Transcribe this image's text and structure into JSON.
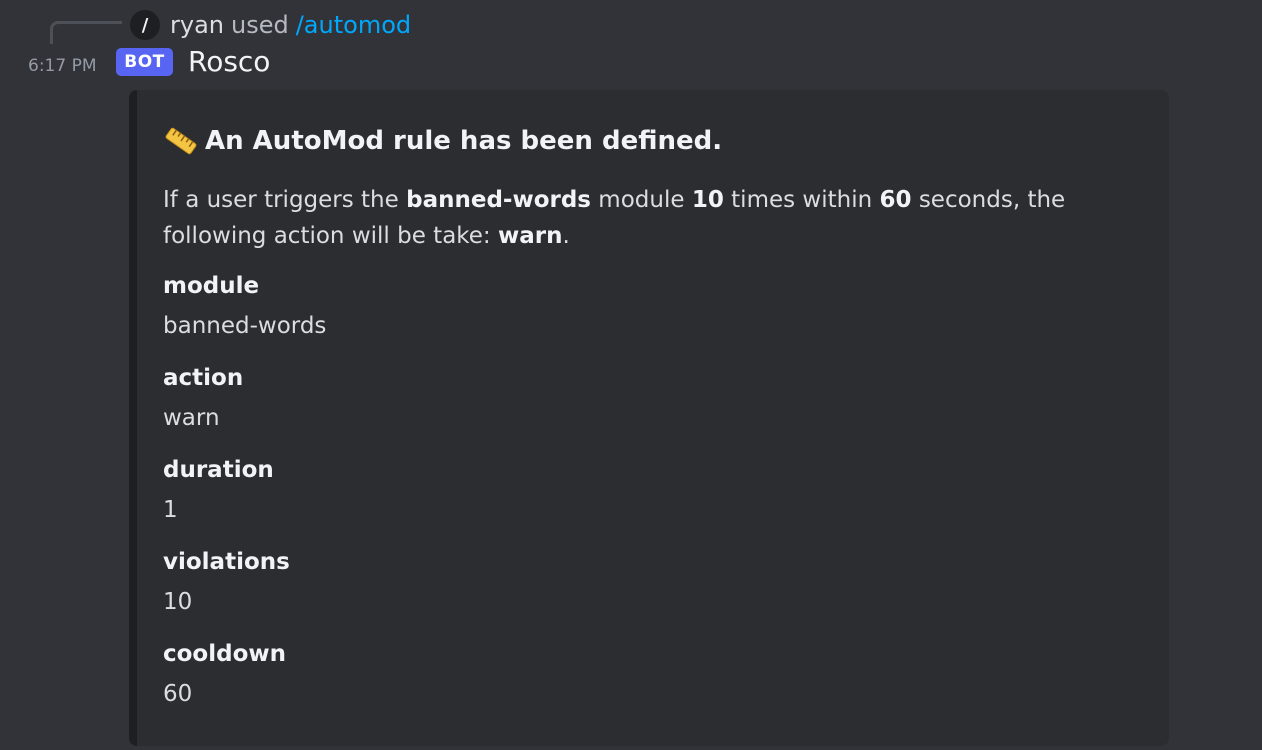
{
  "reply": {
    "icon": "slash-command-icon",
    "user": "ryan",
    "used_text": "used",
    "command": "/automod"
  },
  "message": {
    "timestamp": "6:17 PM",
    "bot_tag": "BOT",
    "author": "Rosco"
  },
  "embed": {
    "title_icon": "ruler-icon",
    "title": "An AutoMod rule has been defined.",
    "description": {
      "part1": "If a user triggers the ",
      "module": "banned-words",
      "part2": " module ",
      "violations": "10",
      "part3": " times within ",
      "seconds": "60",
      "part4": " seconds, the following action will be take: ",
      "action": "warn",
      "part5": "."
    },
    "fields": [
      {
        "name": "module",
        "value": "banned-words"
      },
      {
        "name": "action",
        "value": "warn"
      },
      {
        "name": "duration",
        "value": "1"
      },
      {
        "name": "violations",
        "value": "10"
      },
      {
        "name": "cooldown",
        "value": "60"
      }
    ]
  },
  "colors": {
    "background": "#313338",
    "embed_background": "#2b2d31",
    "bot_tag": "#5865f2",
    "command_link": "#00a8fc"
  }
}
